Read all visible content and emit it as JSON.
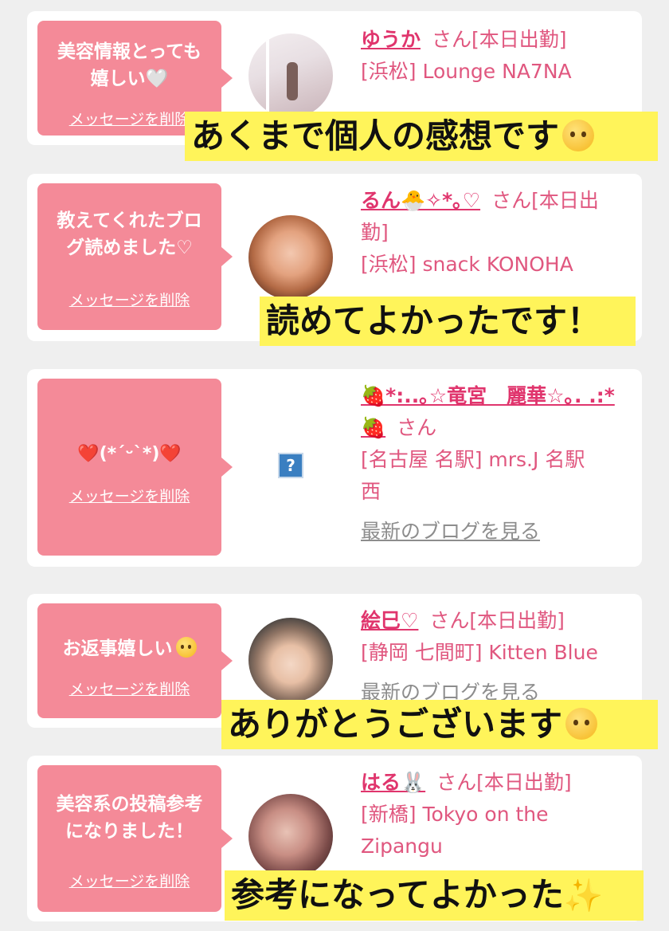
{
  "labels": {
    "delete_message": "メッセージを削除",
    "latest_blog": "最新のブログを見る",
    "honorific_working": "さん[本日出勤]",
    "honorific_working_split": "さん[本日出",
    "honorific_working_split2": "勤]",
    "honorific": "さん"
  },
  "cards": [
    {
      "message_line1": "美容情報とっても",
      "message_line2": "嬉しい🤍",
      "name": "ゆうか",
      "shop": "[浜松] Lounge NA7NA",
      "caption": "あくまで個人の感想です"
    },
    {
      "message_line1": "教えてくれたブロ",
      "message_line2": "グ読めました♡",
      "name": "るん🐣✧*｡♡",
      "shop": "[浜松] snack KONOHA",
      "caption": "読めてよかったです！"
    },
    {
      "message_line1": "❤️(*´ᵕ`*)❤️",
      "name_line1": "🍓*:..｡☆竜宮　麗華☆｡. .:*",
      "name_line2": "🍓",
      "shop_line1": "[名古屋 名駅] mrs.J 名駅",
      "shop_line2": "西",
      "placeholder": "?"
    },
    {
      "message_line1": "お返事嬉しい",
      "name": "絵巳♡",
      "shop": "[静岡 七間町] Kitten Blue",
      "blog_partial": "最新のブログを見る",
      "caption": "ありがとうございます"
    },
    {
      "message_line1": "美容系の投稿参考",
      "message_line2": "になりました！",
      "name": "はる🐰",
      "shop_line1": "[新橋] Tokyo on the",
      "shop_line2": "Zipangu",
      "caption": "参考になってよかった"
    }
  ],
  "colors": {
    "bubble": "#f48a98",
    "name": "#e0356d",
    "caption_bg": "#fff45a",
    "background": "#efefef"
  },
  "icons": [
    "smiley-emoji-icon",
    "pleading-emoji-icon",
    "sparkles-icon",
    "broken-image-icon"
  ]
}
